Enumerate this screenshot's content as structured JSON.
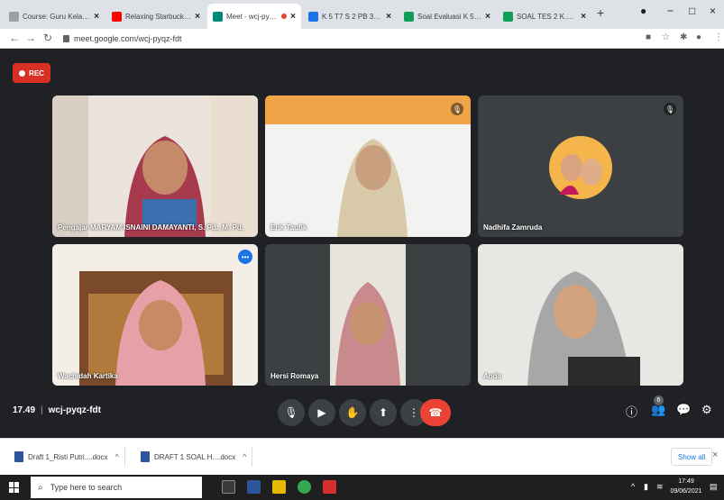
{
  "browser": {
    "tabs": [
      {
        "title": "Course: Guru Kelas SD",
        "color": "#9aa0a6"
      },
      {
        "title": "Relaxing Starbucks In",
        "color": "#ff0000"
      },
      {
        "title": "Meet - wcj-pyqz-",
        "color": "#00897b",
        "active": true
      },
      {
        "title": "K 5 T7 S 2 PB 3 - Goo",
        "color": "#1a73e8"
      },
      {
        "title": "Soal Evaluasi K 5 T 7 S",
        "color": "#0f9d58"
      },
      {
        "title": "SOAL TES 2 K.D 3.4 (",
        "color": "#0f9d58"
      }
    ],
    "url": "meet.google.com/wcj-pyqz-fdt"
  },
  "meet": {
    "rec_label": "REC",
    "time": "17.49",
    "meeting_code": "wcj-pyqz-fdt",
    "participant_badge": "6",
    "participants": [
      {
        "name": "Pengajar MARYAM ISNAINI DAMAYANTI, S. Pd., M. Pd."
      },
      {
        "name": "Erik Taufik"
      },
      {
        "name": "Nadhifa Zamruda"
      },
      {
        "name": "Wachidah Kartika"
      },
      {
        "name": "Hersi Romaya"
      },
      {
        "name": "Anda"
      }
    ]
  },
  "downloads": {
    "items": [
      {
        "label": "Draft 1_Risti Putri....docx"
      },
      {
        "label": "DRAFT 1 SOAL H....docx"
      }
    ],
    "show_all": "Show all"
  },
  "taskbar": {
    "search_placeholder": "Type here to search",
    "clock_time": "17:49",
    "clock_date": "09/06/2021"
  }
}
